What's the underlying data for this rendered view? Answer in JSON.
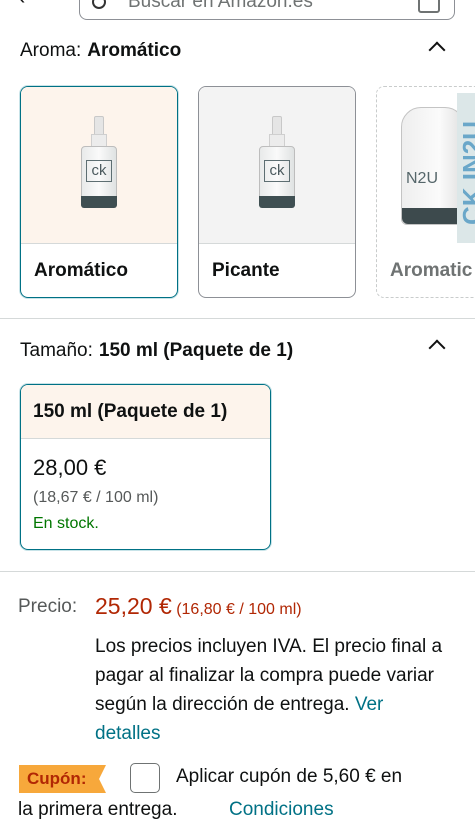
{
  "search": {
    "placeholder": "Buscar en Amazon.es"
  },
  "aroma": {
    "label": "Aroma:",
    "selected": "Aromático",
    "options": [
      {
        "label": "Aromático",
        "state": "selected"
      },
      {
        "label": "Picante",
        "state": "available"
      },
      {
        "label": "Aromatic",
        "state": "unavailable"
      }
    ],
    "bottle_mark": "ck",
    "pack_mark": "N2U",
    "pack_text": "CK IN2U"
  },
  "size": {
    "label": "Tamaño:",
    "selected": "150 ml (Paquete de 1)",
    "card": {
      "title": "150 ml (Paquete de 1)",
      "price": "28,00 €",
      "unit_price": "(18,67 € / 100 ml)",
      "stock": "En stock."
    }
  },
  "price": {
    "label": "Precio:",
    "value": "25,20 €",
    "unit": "(16,80 € / 100 ml)",
    "note": "Los precios incluyen IVA. El precio final a pagar al finalizar la compra puede variar según la dirección de entrega.",
    "details_link": "Ver detalles"
  },
  "coupon": {
    "badge": "Cupón:",
    "text_line1": "Aplicar cupón de 5,60 € en",
    "text_line2": "la primera entrega.",
    "terms_link": "Condiciones"
  },
  "colors": {
    "accent_teal": "#007185",
    "price_red": "#b12704",
    "stock_green": "#007600",
    "coupon_orange": "#f7a83b",
    "selected_bg": "#fdf4ec"
  }
}
